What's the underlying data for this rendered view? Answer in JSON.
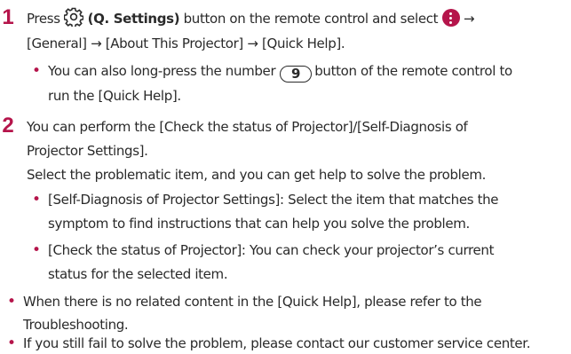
{
  "steps": [
    {
      "number": "1",
      "lines": [
        {
          "pre": "Press",
          "icon_gear": "gear-icon",
          "bold": "(Q. Settings)",
          "post": "button on the remote control and select",
          "icon_more": "more-options-icon",
          "arrow": "→"
        },
        {
          "text": "[General] → [About This Projector] → [Quick Help]."
        }
      ],
      "bullets": [
        {
          "line1_pre": "You can also long-press the number",
          "key": "9",
          "line1_post": "button of the remote control to",
          "line2": "run the [Quick Help]."
        }
      ]
    },
    {
      "number": "2",
      "lines": [
        {
          "text": "You can perform the [Check the status of Projector]/[Self-Diagnosis of"
        },
        {
          "text": "Projector Settings]."
        },
        {
          "text": "Select the problematic item, and you can get help to solve the problem."
        }
      ],
      "bullets": [
        {
          "line1": "[Self-Diagnosis of Projector Settings]: Select the item that matches the",
          "line2": "symptom to find instructions that can help you solve the problem."
        },
        {
          "line1": "[Check the status of Projector]: You can check your projector’s current",
          "line2": "status for the selected item."
        }
      ]
    }
  ],
  "notes": [
    {
      "line1": "When there is no related content in the [Quick Help], please refer to the",
      "line2": "Troubleshooting."
    },
    {
      "line1": "If you still fail to solve the problem, please contact our customer service center."
    }
  ],
  "bullet_glyph": "•",
  "accent_color": "#b5154b"
}
